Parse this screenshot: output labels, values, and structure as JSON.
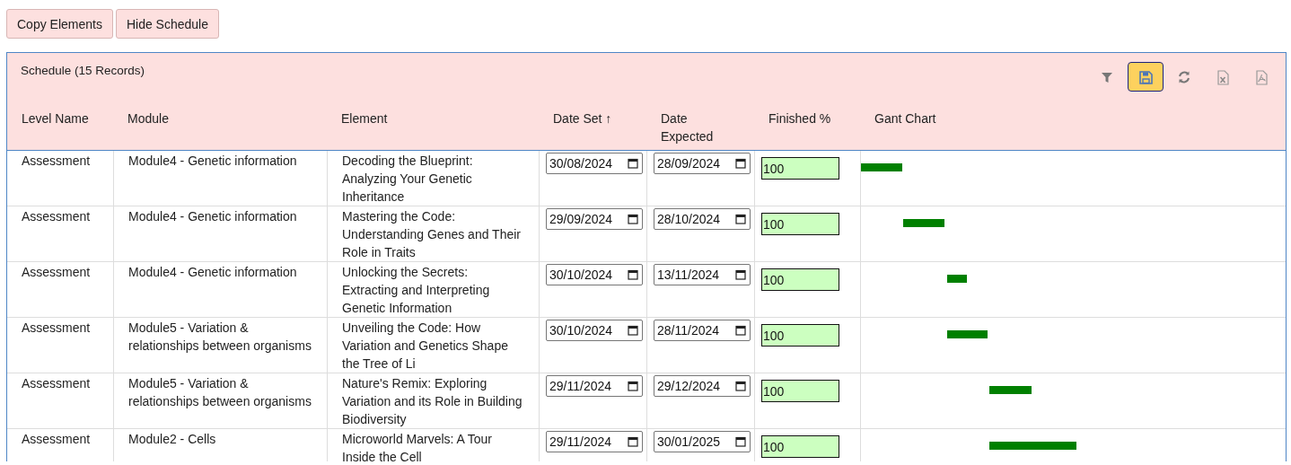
{
  "buttons": [
    {
      "label": "Copy Elements"
    },
    {
      "label": "Hide Schedule"
    }
  ],
  "panel": {
    "title": "Schedule (15 Records)",
    "toolbar": [
      {
        "kind": "filter",
        "selected": false
      },
      {
        "kind": "save",
        "selected": true
      },
      {
        "kind": "refresh",
        "selected": false
      },
      {
        "kind": "excel",
        "selected": false
      },
      {
        "kind": "pdf",
        "selected": false
      }
    ]
  },
  "table": {
    "columns": [
      {
        "label": "Level Name"
      },
      {
        "label": "Module"
      },
      {
        "label": "Element"
      },
      {
        "label": "Date Set ↑"
      },
      {
        "label": "Date Expected"
      },
      {
        "label": "Finished %"
      },
      {
        "label": "Gant Chart"
      }
    ],
    "rows": [
      {
        "level_name": "Assessment",
        "module": "Module4 - Genetic information",
        "element": "Decoding the Blueprint: Analyzing Your Genetic Inheritance",
        "date_set": "30/08/2024",
        "date_expected": "28/09/2024",
        "finished": "100"
      },
      {
        "level_name": "Assessment",
        "module": "Module4 - Genetic information",
        "element": "Mastering the Code: Understanding Genes and Their Role in Traits",
        "date_set": "29/09/2024",
        "date_expected": "28/10/2024",
        "finished": "100"
      },
      {
        "level_name": "Assessment",
        "module": "Module4 - Genetic information",
        "element": "Unlocking the Secrets: Extracting and Interpreting Genetic Information",
        "date_set": "30/10/2024",
        "date_expected": "13/11/2024",
        "finished": "100"
      },
      {
        "level_name": "Assessment",
        "module": "Module5 - Variation & relationships between organisms",
        "element": "Unveiling the Code: How Variation and Genetics Shape the Tree of Li",
        "date_set": "30/10/2024",
        "date_expected": "28/11/2024",
        "finished": "100"
      },
      {
        "level_name": "Assessment",
        "module": "Module5 - Variation & relationships between organisms",
        "element": "Nature's Remix: Exploring Variation and its Role in Building Biodiversity",
        "date_set": "29/11/2024",
        "date_expected": "29/12/2024",
        "finished": "100"
      },
      {
        "level_name": "Assessment",
        "module": "Module2 - Cells",
        "element": "Microworld Marvels: A Tour Inside the Cell",
        "date_set": "29/11/2024",
        "date_expected": "30/01/2025",
        "finished": "100"
      }
    ]
  }
}
